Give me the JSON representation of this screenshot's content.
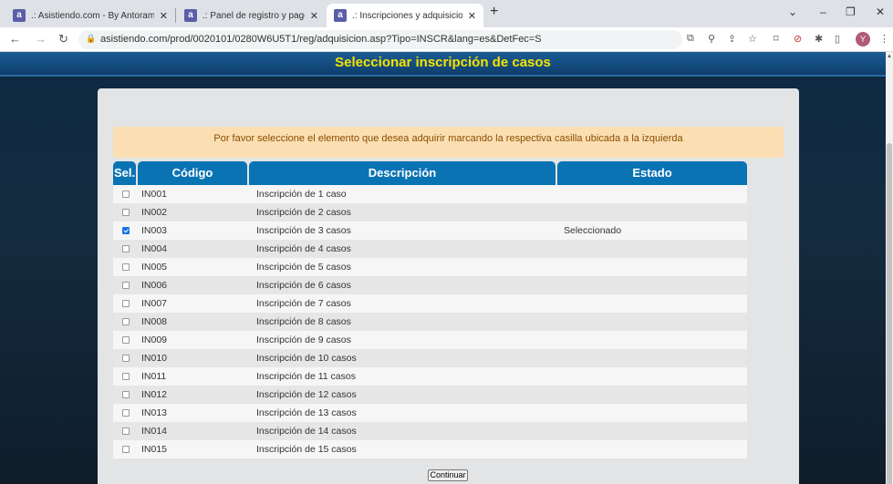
{
  "browser": {
    "tabs": [
      {
        "title": ".: Asistiendo.com - By Antorami :."
      },
      {
        "title": ".: Panel de registro y pagos :."
      },
      {
        "title": ".: Inscripciones y adquisiciones :."
      }
    ],
    "favicon_letter": "a",
    "close_glyph": "✕",
    "new_tab_glyph": "+",
    "window_controls": [
      "⌄",
      "–",
      "❐",
      "✕"
    ],
    "nav": {
      "back": "←",
      "forward": "→",
      "reload": "↻"
    },
    "url": "asistiendo.com/prod/0020101/0280W6U5T1/reg/adquisicion.asp?Tipo=INSCR&lang=es&DetFec=S",
    "extension_icons": [
      "translate-icon",
      "zoom-icon",
      "share-icon",
      "star-icon",
      "tab-search-icon",
      "block-icon",
      "puzzle-icon",
      "sidepanel-icon"
    ],
    "extension_glyphs": [
      "⧉",
      "⚲",
      "⇪",
      "☆",
      "⌑",
      "⊘",
      "✱",
      "▯"
    ],
    "profile_initial": "Y",
    "menu_glyph": "⋮"
  },
  "page": {
    "title": "Seleccionar inscripción de casos",
    "notice": "Por favor seleccione el elemento que desea adquirir marcando la respectiva casilla ubicada a la izquierda",
    "columns": {
      "sel": "Sel.",
      "code": "Código",
      "description": "Descripción",
      "status": "Estado"
    },
    "rows": [
      {
        "code": "IN001",
        "description": "Inscripción de 1 caso",
        "status": "",
        "checked": false
      },
      {
        "code": "IN002",
        "description": "Inscripción de 2 casos",
        "status": "",
        "checked": false
      },
      {
        "code": "IN003",
        "description": "Inscripción de 3 casos",
        "status": "Seleccionado",
        "checked": true
      },
      {
        "code": "IN004",
        "description": "Inscripción de 4 casos",
        "status": "",
        "checked": false
      },
      {
        "code": "IN005",
        "description": "Inscripción de 5 casos",
        "status": "",
        "checked": false
      },
      {
        "code": "IN006",
        "description": "Inscripción de 6 casos",
        "status": "",
        "checked": false
      },
      {
        "code": "IN007",
        "description": "Inscripción de 7 casos",
        "status": "",
        "checked": false
      },
      {
        "code": "IN008",
        "description": "Inscripción de 8 casos",
        "status": "",
        "checked": false
      },
      {
        "code": "IN009",
        "description": "Inscripción de 9 casos",
        "status": "",
        "checked": false
      },
      {
        "code": "IN010",
        "description": "Inscripción de 10 casos",
        "status": "",
        "checked": false
      },
      {
        "code": "IN011",
        "description": "Inscripción de 11 casos",
        "status": "",
        "checked": false
      },
      {
        "code": "IN012",
        "description": "Inscripción de 12 casos",
        "status": "",
        "checked": false
      },
      {
        "code": "IN013",
        "description": "Inscripción de 13 casos",
        "status": "",
        "checked": false
      },
      {
        "code": "IN014",
        "description": "Inscripción de 14 casos",
        "status": "",
        "checked": false
      },
      {
        "code": "IN015",
        "description": "Inscripción de 15 casos",
        "status": "",
        "checked": false
      }
    ],
    "continue_label": "Continuar"
  },
  "colors": {
    "title_yellow": "#f4e300",
    "header_blue": "#0a73b3",
    "notice_bg": "#fbdfb2",
    "checkbox_checked": "#1a73e8"
  }
}
